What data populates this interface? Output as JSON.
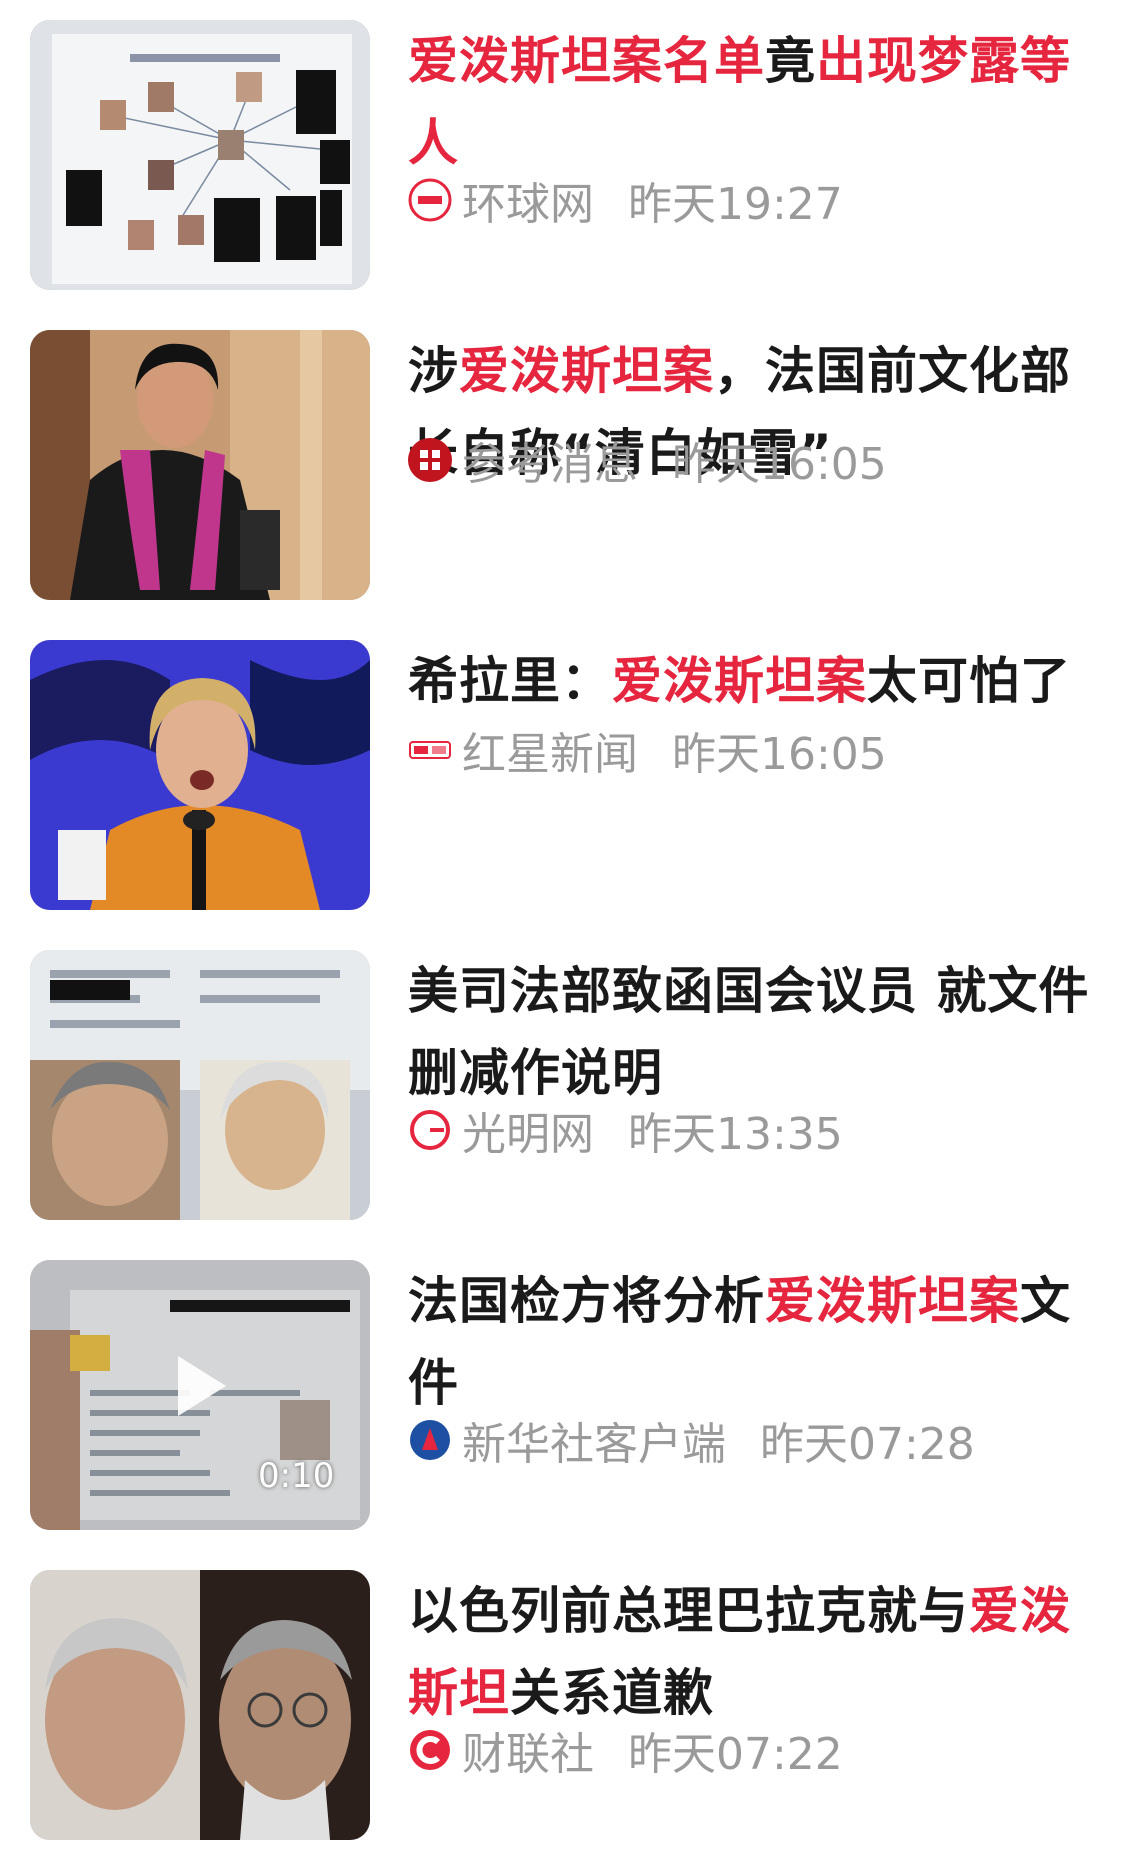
{
  "accent_color": "#e6253e",
  "meta_color": "#9a9a9a",
  "items": [
    {
      "title_parts": [
        {
          "text": "爱泼斯坦案名单",
          "hl": true
        },
        {
          "text": "竟",
          "hl": false
        },
        {
          "text": "出现梦露等人",
          "hl": true
        }
      ],
      "source": "环球网",
      "logo_icon": "huanqiu-logo-icon",
      "time": "昨天19:27"
    },
    {
      "title_parts": [
        {
          "text": "涉",
          "hl": false
        },
        {
          "text": "爱泼斯坦案",
          "hl": true
        },
        {
          "text": "，法国前文化部长自称“清白如雪”",
          "hl": false
        }
      ],
      "source": "参考消息",
      "logo_icon": "cankao-logo-icon",
      "time": "昨天16:05"
    },
    {
      "title_parts": [
        {
          "text": "希拉里：",
          "hl": false
        },
        {
          "text": "爱泼斯坦案",
          "hl": true
        },
        {
          "text": "太可怕了",
          "hl": false
        }
      ],
      "source": "红星新闻",
      "logo_icon": "hongxing-logo-icon",
      "time": "昨天16:05"
    },
    {
      "title_parts": [
        {
          "text": "美司法部致函国会议员 就文件删减作说明",
          "hl": false
        }
      ],
      "source": "光明网",
      "logo_icon": "guangming-logo-icon",
      "time": "昨天13:35"
    },
    {
      "title_parts": [
        {
          "text": "法国检方将分析",
          "hl": false
        },
        {
          "text": "爱泼斯坦案",
          "hl": true
        },
        {
          "text": "文件",
          "hl": false
        }
      ],
      "source": "新华社客户端",
      "logo_icon": "xinhua-logo-icon",
      "time": "昨天07:28",
      "video_duration": "0:10"
    },
    {
      "title_parts": [
        {
          "text": "以色列前总理巴拉克就与",
          "hl": false
        },
        {
          "text": "爱泼斯坦",
          "hl": true
        },
        {
          "text": "关系道歉",
          "hl": false
        }
      ],
      "source": "财联社",
      "logo_icon": "cailian-logo-icon",
      "time": "昨天07:22"
    }
  ]
}
